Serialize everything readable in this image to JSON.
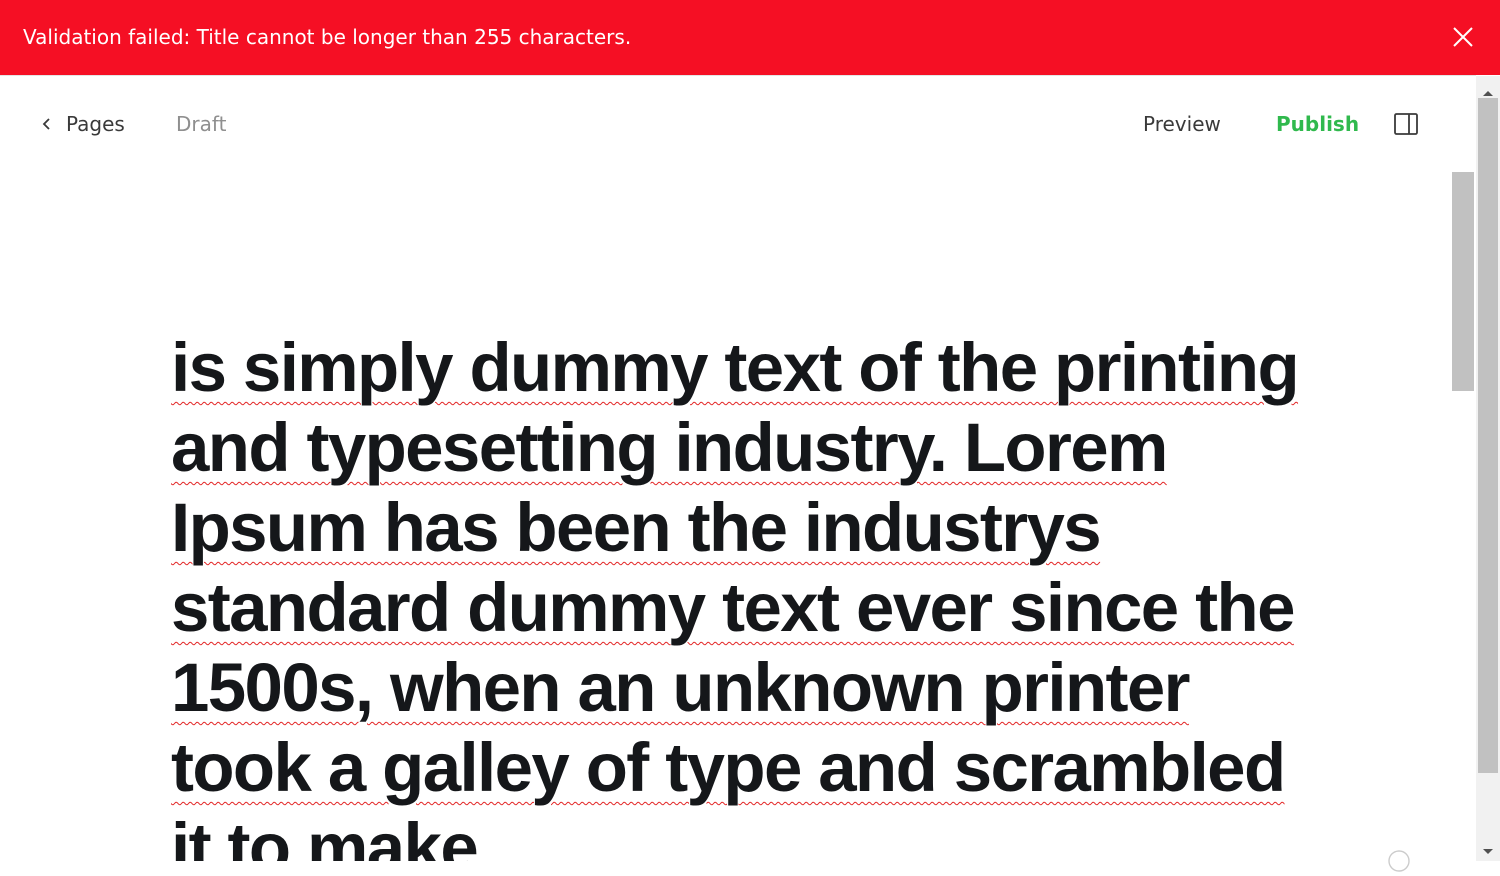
{
  "banner": {
    "message": "Validation failed: Title cannot be longer than 255 characters.",
    "close_icon": "close-icon",
    "background": "#f50f24"
  },
  "header": {
    "back_label": "Pages",
    "status": "Draft",
    "preview_label": "Preview",
    "publish_label": "Publish",
    "publish_color": "#30b94d",
    "panel_icon": "sidebar-toggle-icon"
  },
  "editor": {
    "title": "is simply dummy text of the printing and typesetting industry. Lorem Ipsum has been the industrys standard dummy text ever since the 1500s, when an unknown printer took a galley of type and scrambled it to make"
  }
}
